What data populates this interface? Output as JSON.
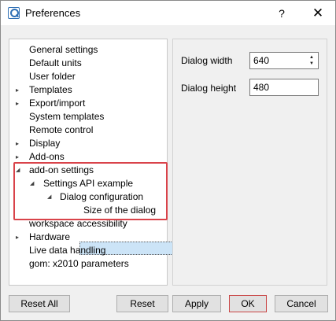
{
  "window": {
    "title": "Preferences",
    "help_label": "?",
    "close_label": "✕"
  },
  "icons": {
    "app": "gom-app-icon",
    "expand": "triangle-right-icon",
    "collapse": "triangle-down-icon"
  },
  "colors": {
    "highlight": "#d9434a",
    "selection": "#cce4f7",
    "ok_border": "#c94444"
  },
  "tree": {
    "items": [
      {
        "label": "General settings"
      },
      {
        "label": "Default units"
      },
      {
        "label": "User folder"
      },
      {
        "label": "Templates",
        "expander": "▸"
      },
      {
        "label": "Export/import",
        "expander": "▸"
      },
      {
        "label": "System templates"
      },
      {
        "label": "Remote control"
      },
      {
        "label": "Display",
        "expander": "▸"
      },
      {
        "label": "Add-ons",
        "expander": "▸"
      },
      {
        "label": "add-on settings",
        "expander": "◢"
      },
      {
        "label": "Settings API example",
        "expander": "◢"
      },
      {
        "label": "Dialog configuration",
        "expander": "◢"
      },
      {
        "label": "Size of the dialog",
        "selected": true
      },
      {
        "label": "workspace accessibility"
      },
      {
        "label": "Hardware",
        "expander": "▸"
      },
      {
        "label": "Live data handling"
      },
      {
        "label": "gom: x2010 parameters"
      }
    ]
  },
  "settings": {
    "dialog_width": {
      "label": "Dialog width",
      "value": "640"
    },
    "dialog_height": {
      "label": "Dialog height",
      "value": "480"
    },
    "spin_up": "▲",
    "spin_down": "▼"
  },
  "buttons": {
    "reset_all": "Reset All",
    "reset": "Reset",
    "apply": "Apply",
    "ok": "OK",
    "cancel": "Cancel"
  }
}
